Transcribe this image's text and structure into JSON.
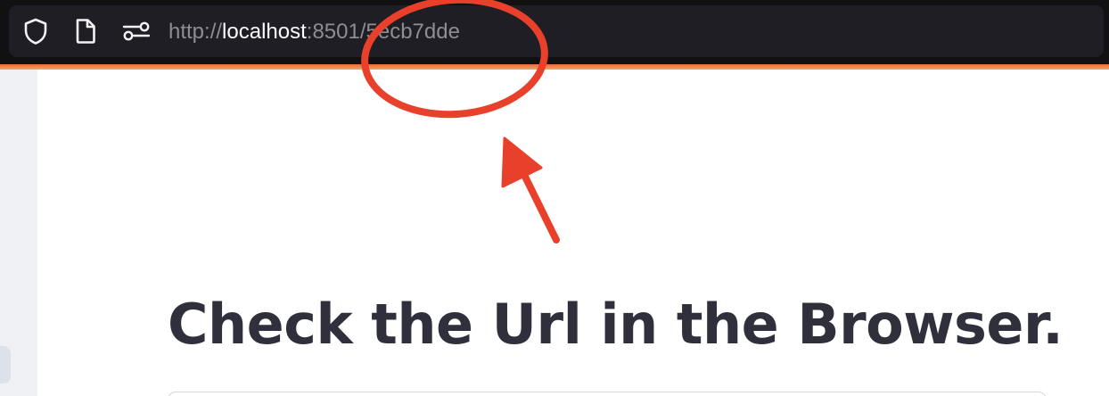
{
  "browser": {
    "url": {
      "scheme": "http://",
      "host": "localhost",
      "port_and_path": ":8501/5ecb7dde"
    },
    "icons": [
      "shield-icon",
      "page-icon",
      "permissions-icon"
    ],
    "colors": {
      "toolbar": "#111114",
      "urlbar": "#1f1e25",
      "url_dim": "#8e8d93",
      "url_host": "#fbfbfe",
      "accent": "#e36b3e"
    }
  },
  "main": {
    "title": "Check the Url in the Browser.",
    "title_color": "#30303d"
  },
  "annotation": {
    "shapes": [
      "highlight-ellipse",
      "arrow"
    ],
    "color": "#e8402a"
  }
}
